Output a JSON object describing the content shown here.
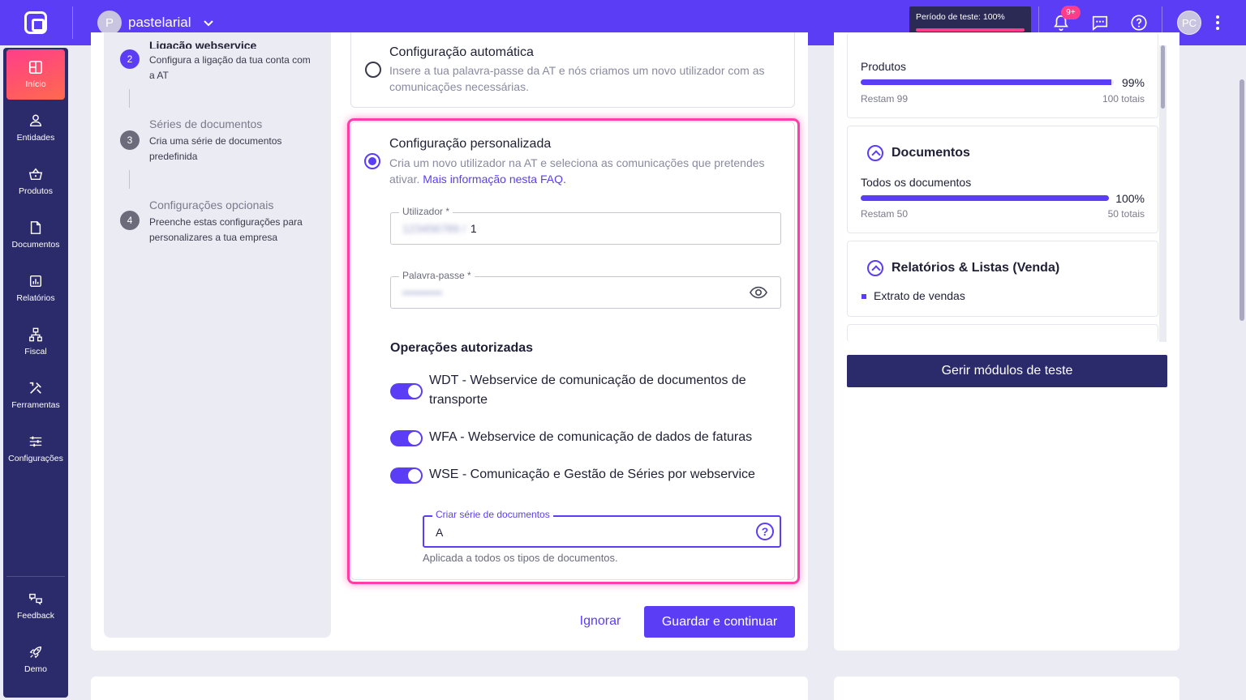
{
  "workspace": {
    "initial": "P",
    "name": "pastelarial"
  },
  "trial": {
    "label": "Período de teste: 100%",
    "progress": 1.0
  },
  "notifications": {
    "badge": "9+"
  },
  "user": {
    "initials": "PC"
  },
  "sidebar": {
    "items": [
      {
        "label": "Início",
        "icon": "home-icon",
        "active": true
      },
      {
        "label": "Entidades",
        "icon": "person-icon"
      },
      {
        "label": "Produtos",
        "icon": "basket-icon"
      },
      {
        "label": "Documentos",
        "icon": "document-icon"
      },
      {
        "label": "Relatórios",
        "icon": "chart-icon"
      },
      {
        "label": "Fiscal",
        "icon": "hierarchy-icon"
      },
      {
        "label": "Ferramentas",
        "icon": "tools-icon"
      },
      {
        "label": "Configurações",
        "icon": "sliders-icon"
      }
    ],
    "bottom": [
      {
        "label": "Feedback",
        "icon": "feedback-icon"
      },
      {
        "label": "Demo",
        "icon": "rocket-icon"
      }
    ]
  },
  "steps": [
    {
      "num": "2",
      "title": "Ligação webservice",
      "desc": "Configura a ligação da tua conta com a AT"
    },
    {
      "num": "3",
      "title": "Séries de documentos",
      "desc": "Cria uma série de documentos predefinida"
    },
    {
      "num": "4",
      "title": "Configurações opcionais",
      "desc": "Preenche estas configurações para personalizares a tua empresa"
    }
  ],
  "auto_config": {
    "title": "Configuração automática",
    "desc": "Insere a tua palavra-passe da AT e nós criamos um novo utilizador com as comunicações necessárias."
  },
  "custom_config": {
    "title": "Configuração personalizada",
    "desc": "Cria um novo utilizador na AT e seleciona as comunicações que pretendes ativar.",
    "link": "Mais informação nesta FAQ."
  },
  "user_field": {
    "label": "Utilizador *",
    "value": "1",
    "masked": "123456789 /"
  },
  "password_field": {
    "label": "Palavra-passe *",
    "masked": "••••••••••"
  },
  "operations": {
    "title": "Operações autorizadas",
    "items": [
      {
        "label": "WDT - Webservice de comunicação de documentos de transporte",
        "on": true
      },
      {
        "label": "WFA - Webservice de comunicação de dados de faturas",
        "on": true
      },
      {
        "label": "WSE - Comunicação e Gestão de Séries por webservice",
        "on": true
      }
    ]
  },
  "series_field": {
    "label": "Criar série de documentos",
    "value": "A",
    "hint": "Aplicada a todos os tipos de documentos.",
    "help": "?"
  },
  "actions": {
    "ignore": "Ignorar",
    "save": "Guardar e continuar"
  },
  "modules": {
    "produtos": {
      "label": "Produtos",
      "percent": "99%",
      "progress": 0.99,
      "left": "Restam 99",
      "total": "100 totais"
    },
    "documentos": {
      "title": "Documentos",
      "label": "Todos os documentos",
      "percent": "100%",
      "progress": 1.0,
      "left": "Restam 50",
      "total": "50 totais"
    },
    "relatorios": {
      "title": "Relatórios & Listas (Venda)",
      "item": "Extrato de vendas"
    },
    "manage_button": "Gerir módulos de teste"
  },
  "colors": {
    "accent": "#5b3df5",
    "topbar": "#5b3df5",
    "sidebar": "#2b2a6b",
    "highlight": "#ff3da8",
    "badge": "#ff3d8b"
  }
}
